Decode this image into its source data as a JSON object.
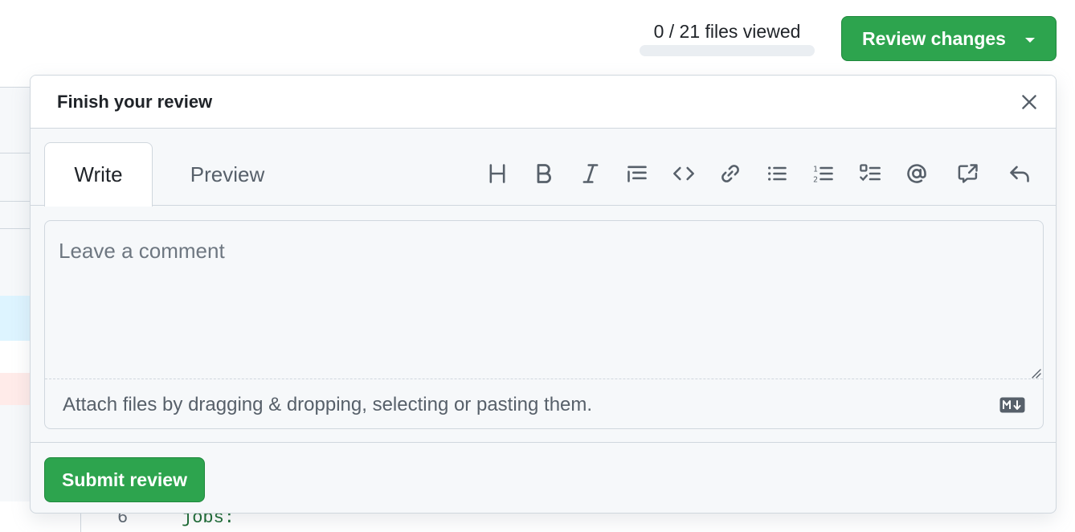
{
  "header": {
    "files_viewed_text": "0 / 21 files viewed",
    "files_viewed_progress": 0,
    "review_button_label": "Review changes"
  },
  "popover": {
    "title": "Finish your review",
    "tabs": [
      {
        "label": "Write",
        "active": true
      },
      {
        "label": "Preview",
        "active": false
      }
    ],
    "toolbar": [
      {
        "icon": "heading-icon"
      },
      {
        "icon": "bold-icon"
      },
      {
        "icon": "italic-icon"
      },
      {
        "icon": "quote-icon"
      },
      {
        "icon": "code-icon"
      },
      {
        "icon": "link-icon"
      },
      {
        "icon": "unordered-list-icon"
      },
      {
        "icon": "ordered-list-icon"
      },
      {
        "icon": "task-list-icon"
      },
      {
        "icon": "mention-icon"
      },
      {
        "icon": "cross-reference-icon"
      },
      {
        "icon": "reply-icon"
      }
    ],
    "comment": {
      "value": "",
      "placeholder": "Leave a comment"
    },
    "attach_text": "Attach files by dragging & dropping, selecting or pasting them.",
    "submit_label": "Submit review"
  },
  "background": {
    "code_line_number": "6",
    "code_line_text": "jobs:"
  },
  "colors": {
    "primary_green": "#2da44e",
    "border": "#d0d7de",
    "muted_text": "#57606a"
  }
}
